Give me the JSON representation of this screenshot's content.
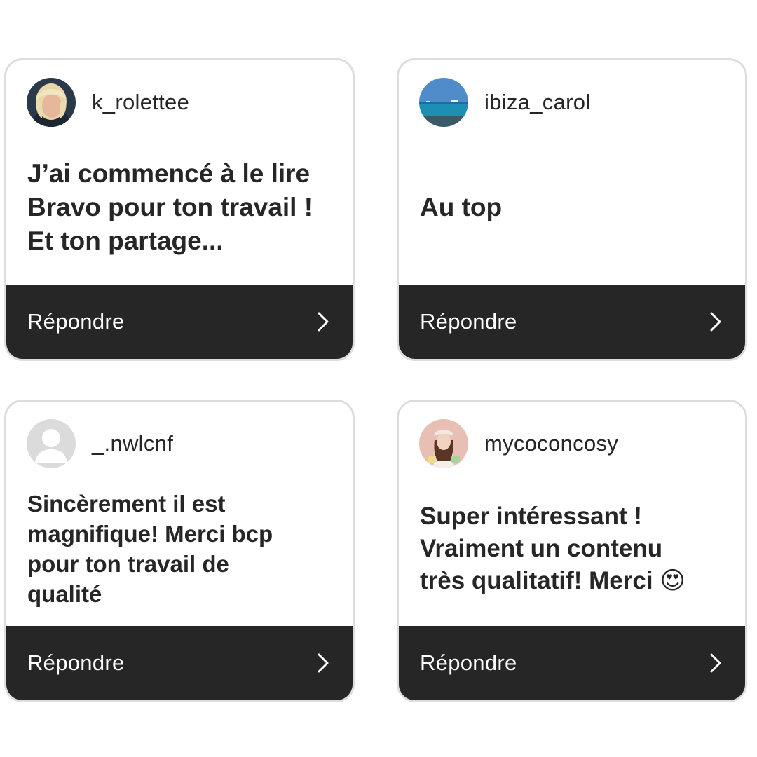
{
  "reply_label": "Répondre",
  "colors": {
    "card_border": "#dddddd",
    "footer_bg": "#262626",
    "text": "#262626"
  },
  "cards": [
    {
      "username": "k_rolettee",
      "avatar_icon": "profile-photo-blonde-woman",
      "lines": [
        "J’ai commencé à le lire",
        "Bravo pour ton travail !",
        "Et ton partage..."
      ]
    },
    {
      "username": "ibiza_carol",
      "avatar_icon": "profile-photo-sea",
      "lines": [
        "Au top"
      ]
    },
    {
      "username": "_.nwlcnf",
      "avatar_icon": "default-avatar-icon",
      "lines": [
        "Sincèrement il est",
        "magnifique! Merci bcp",
        "pour ton travail de",
        "qualité"
      ]
    },
    {
      "username": "mycoconcosy",
      "avatar_icon": "profile-illustration-girl",
      "lines": [
        "Super intéressant !",
        "Vraiment un contenu",
        "très qualitatif! Merci"
      ],
      "emoji": "😍"
    }
  ]
}
